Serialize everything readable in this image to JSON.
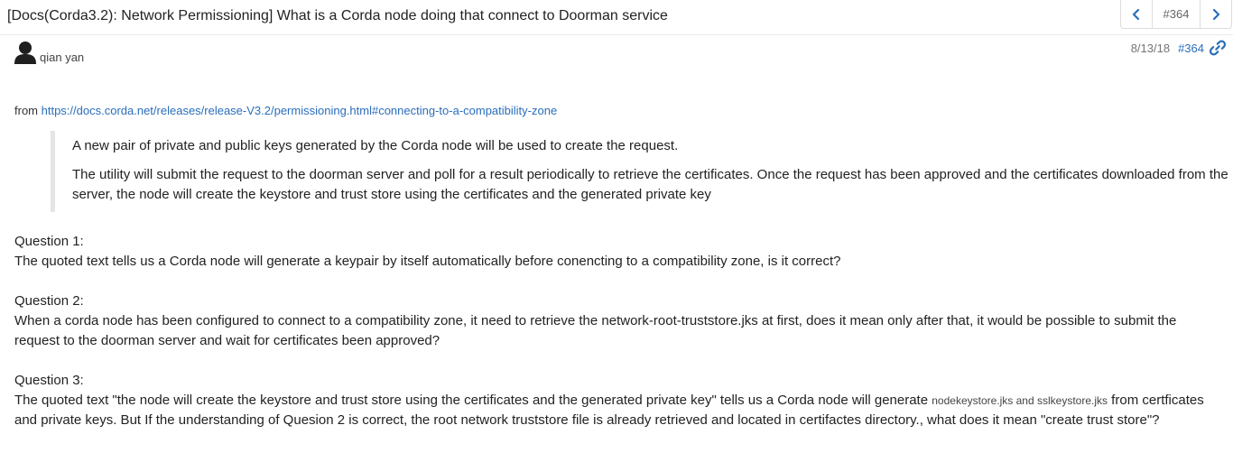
{
  "topic": {
    "title": "[Docs(Corda3.2): Network Permissioning] What is a Corda node doing that connect to Doorman service",
    "post_number": "#364",
    "prev_icon": "chevron-left-icon",
    "next_icon": "chevron-right-icon"
  },
  "post": {
    "username": "qian yan",
    "avatar_icon": "user-avatar-icon",
    "date": "8/13/18",
    "number": "#364",
    "link_icon": "link-icon",
    "from_label": "from",
    "from_url": "https://docs.corda.net/releases/release-V3.2/permissioning.html#connecting-to-a-compatibility-zone",
    "quote": [
      "A new pair of private and public keys generated by the Corda node will be used to create the request.",
      "The utility will submit the request to the doorman server and poll for a result periodically to retrieve the certificates. Once the request has been approved and the certificates downloaded from the server, the node will create the keystore and trust store using the certificates and the generated private key"
    ],
    "questions": [
      {
        "label": "Question 1:",
        "text": "The quoted text tells us a Corda node will generate a keypair by itself automatically before conencting to a compatibility zone, is it correct?"
      },
      {
        "label": "Question 2:",
        "text": "When a corda node has been configured to connect to a compatibility zone, it need to retrieve the network-root-truststore.jks at first, does it mean only after that, it would be possible to submit the request to the doorman server and wait for certificates been approved?"
      },
      {
        "label": "Question 3:",
        "text_before": "The quoted text \"the node will create the keystore and trust store using the certificates and the generated private key\" tells us a Corda node will generate ",
        "code": "nodekeystore.jks and sslkeystore.jks",
        "text_after": " from certficates and private keys. But If the understanding of Quesion 2 is correct, the root network truststore file is already retrieved and located in certifactes directory., what does it mean \"create trust store\"?"
      }
    ]
  },
  "colors": {
    "link": "#2a6ebb",
    "text": "#222222",
    "muted": "#757575",
    "quote_border": "#e5e5e5"
  }
}
